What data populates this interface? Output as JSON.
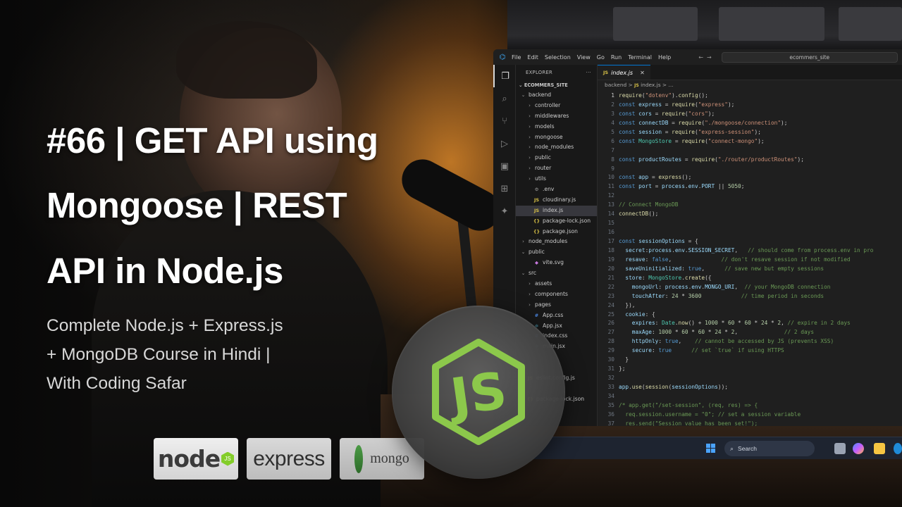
{
  "title_lines": [
    "#66 | GET API using",
    "Mongoose | REST",
    "API in Node.js"
  ],
  "subtitle_lines": [
    "Complete Node.js + Express.js",
    "+ MongoDB Course in Hindi |",
    "With Coding Safar"
  ],
  "badges": {
    "node": "node",
    "node_js": "JS",
    "express": "express",
    "mongo": "mongo"
  },
  "circle_logo": "JS",
  "vscode": {
    "menu": [
      "File",
      "Edit",
      "Selection",
      "View",
      "Go",
      "Run",
      "Terminal",
      "Help"
    ],
    "search": "ecommers_site",
    "explorer_title": "EXPLORER",
    "explorer_more": "···",
    "root_folder": "ECOMMERS_SITE",
    "tab": {
      "icon": "JS",
      "label": "index.js"
    },
    "breadcrumb": {
      "folder": "backend",
      "sep": ">",
      "icon": "JS",
      "file": "index.js",
      "tail": "> ..."
    },
    "tree": [
      {
        "label": "backend",
        "depth": 0,
        "chev": "⌄",
        "icon": ""
      },
      {
        "label": "controller",
        "depth": 1,
        "chev": "›",
        "icon": ""
      },
      {
        "label": "middlewares",
        "depth": 1,
        "chev": "›",
        "icon": ""
      },
      {
        "label": "models",
        "depth": 1,
        "chev": "›",
        "icon": ""
      },
      {
        "label": "mongoose",
        "depth": 1,
        "chev": "›",
        "icon": ""
      },
      {
        "label": "node_modules",
        "depth": 1,
        "chev": "›",
        "icon": ""
      },
      {
        "label": "public",
        "depth": 1,
        "chev": "›",
        "icon": ""
      },
      {
        "label": "router",
        "depth": 1,
        "chev": "›",
        "icon": ""
      },
      {
        "label": "utils",
        "depth": 1,
        "chev": "›",
        "icon": ""
      },
      {
        "label": ".env",
        "depth": 1,
        "chev": "",
        "icon": "⚙"
      },
      {
        "label": "cloudinary.js",
        "depth": 1,
        "chev": "",
        "icon": "JS"
      },
      {
        "label": "index.js",
        "depth": 1,
        "chev": "",
        "icon": "JS",
        "selected": true
      },
      {
        "label": "package-lock.json",
        "depth": 1,
        "chev": "",
        "icon": "{}"
      },
      {
        "label": "package.json",
        "depth": 1,
        "chev": "",
        "icon": "{}"
      },
      {
        "label": "node_modules",
        "depth": 0,
        "chev": "›",
        "icon": ""
      },
      {
        "label": "public",
        "depth": 0,
        "chev": "⌄",
        "icon": ""
      },
      {
        "label": "vite.svg",
        "depth": 1,
        "chev": "",
        "icon": "◆"
      },
      {
        "label": "src",
        "depth": 0,
        "chev": "⌄",
        "icon": ""
      },
      {
        "label": "assets",
        "depth": 1,
        "chev": "›",
        "icon": ""
      },
      {
        "label": "components",
        "depth": 1,
        "chev": "›",
        "icon": ""
      },
      {
        "label": "pages",
        "depth": 1,
        "chev": "›",
        "icon": ""
      },
      {
        "label": "App.css",
        "depth": 1,
        "chev": "",
        "icon": "#"
      },
      {
        "label": "App.jsx",
        "depth": 1,
        "chev": "",
        "icon": "⚛"
      },
      {
        "label": "index.css",
        "depth": 1,
        "chev": "",
        "icon": "#"
      },
      {
        "label": "main.jsx",
        "depth": 1,
        "chev": "",
        "icon": "⚛"
      },
      {
        "label": "",
        "depth": 0,
        "chev": "",
        "icon": ""
      },
      {
        "label": "",
        "depth": 0,
        "chev": "",
        "icon": ""
      },
      {
        "label": "eslint.config.js",
        "depth": 0,
        "chev": "",
        "icon": "JS"
      },
      {
        "label": "",
        "depth": 0,
        "chev": "",
        "icon": ""
      },
      {
        "label": "package-lock.json",
        "depth": 0,
        "chev": "",
        "icon": "{}"
      }
    ],
    "code": [
      [
        [
          "fn",
          "require"
        ],
        [
          "p",
          "("
        ],
        [
          "str",
          "\"dotenv\""
        ],
        [
          "p",
          ")."
        ],
        [
          "fn",
          "config"
        ],
        [
          "p",
          "();"
        ]
      ],
      [
        [
          "kw",
          "const "
        ],
        [
          "var",
          "express"
        ],
        [
          "p",
          " = "
        ],
        [
          "fn",
          "require"
        ],
        [
          "p",
          "("
        ],
        [
          "str",
          "\"express\""
        ],
        [
          "p",
          ");"
        ]
      ],
      [
        [
          "kw",
          "const "
        ],
        [
          "var",
          "cors"
        ],
        [
          "p",
          " = "
        ],
        [
          "fn",
          "require"
        ],
        [
          "p",
          "("
        ],
        [
          "str",
          "\"cors\""
        ],
        [
          "p",
          ");"
        ]
      ],
      [
        [
          "kw",
          "const "
        ],
        [
          "var",
          "connectDB"
        ],
        [
          "p",
          " = "
        ],
        [
          "fn",
          "require"
        ],
        [
          "p",
          "("
        ],
        [
          "str",
          "\"./mongoose/connection\""
        ],
        [
          "p",
          ");"
        ]
      ],
      [
        [
          "kw",
          "const "
        ],
        [
          "var",
          "session"
        ],
        [
          "p",
          " = "
        ],
        [
          "fn",
          "require"
        ],
        [
          "p",
          "("
        ],
        [
          "str",
          "\"express-session\""
        ],
        [
          "p",
          ");"
        ]
      ],
      [
        [
          "kw",
          "const "
        ],
        [
          "cls",
          "MongoStore"
        ],
        [
          "p",
          " = "
        ],
        [
          "fn",
          "require"
        ],
        [
          "p",
          "("
        ],
        [
          "str",
          "\"connect-mongo\""
        ],
        [
          "p",
          ");"
        ]
      ],
      [],
      [
        [
          "kw",
          "const "
        ],
        [
          "var",
          "productRoutes"
        ],
        [
          "p",
          " = "
        ],
        [
          "fn",
          "require"
        ],
        [
          "p",
          "("
        ],
        [
          "str",
          "\"./router/productRoutes\""
        ],
        [
          "p",
          ");"
        ]
      ],
      [],
      [
        [
          "kw",
          "const "
        ],
        [
          "var",
          "app"
        ],
        [
          "p",
          " = "
        ],
        [
          "fn",
          "express"
        ],
        [
          "p",
          "();"
        ]
      ],
      [
        [
          "kw",
          "const "
        ],
        [
          "var",
          "port"
        ],
        [
          "p",
          " = "
        ],
        [
          "var",
          "process"
        ],
        [
          "p",
          "."
        ],
        [
          "var",
          "env"
        ],
        [
          "p",
          "."
        ],
        [
          "var",
          "PORT"
        ],
        [
          "p",
          " || "
        ],
        [
          "num",
          "5050"
        ],
        [
          "p",
          ";"
        ]
      ],
      [],
      [
        [
          "com",
          "// Connect MongoDB"
        ]
      ],
      [
        [
          "fn",
          "connectDB"
        ],
        [
          "p",
          "();"
        ]
      ],
      [],
      [],
      [
        [
          "kw",
          "const "
        ],
        [
          "var",
          "sessionOptions"
        ],
        [
          "p",
          " = {"
        ]
      ],
      [
        [
          "p",
          "  "
        ],
        [
          "var",
          "secret"
        ],
        [
          "p",
          ":"
        ],
        [
          "var",
          "process"
        ],
        [
          "p",
          "."
        ],
        [
          "var",
          "env"
        ],
        [
          "p",
          "."
        ],
        [
          "var",
          "SESSION_SECRET"
        ],
        [
          "p",
          ",   "
        ],
        [
          "com",
          "// should come from process.env in pro"
        ]
      ],
      [
        [
          "p",
          "  "
        ],
        [
          "var",
          "resave"
        ],
        [
          "p",
          ": "
        ],
        [
          "kw",
          "false"
        ],
        [
          "p",
          ",               "
        ],
        [
          "com",
          "// don't resave session if not modified"
        ]
      ],
      [
        [
          "p",
          "  "
        ],
        [
          "var",
          "saveUninitialized"
        ],
        [
          "p",
          ": "
        ],
        [
          "kw",
          "true"
        ],
        [
          "p",
          ",      "
        ],
        [
          "com",
          "// save new but empty sessions"
        ]
      ],
      [
        [
          "p",
          "  "
        ],
        [
          "var",
          "store"
        ],
        [
          "p",
          ": "
        ],
        [
          "cls",
          "MongoStore"
        ],
        [
          "p",
          "."
        ],
        [
          "fn",
          "create"
        ],
        [
          "p",
          "({"
        ]
      ],
      [
        [
          "p",
          "    "
        ],
        [
          "var",
          "mongoUrl"
        ],
        [
          "p",
          ": "
        ],
        [
          "var",
          "process"
        ],
        [
          "p",
          "."
        ],
        [
          "var",
          "env"
        ],
        [
          "p",
          "."
        ],
        [
          "var",
          "MONGO_URI"
        ],
        [
          "p",
          ",  "
        ],
        [
          "com",
          "// your MongoDB connection"
        ]
      ],
      [
        [
          "p",
          "    "
        ],
        [
          "var",
          "touchAfter"
        ],
        [
          "p",
          ": "
        ],
        [
          "num",
          "24"
        ],
        [
          "p",
          " * "
        ],
        [
          "num",
          "3600"
        ],
        [
          "p",
          "            "
        ],
        [
          "com",
          "// time period in seconds"
        ]
      ],
      [
        [
          "p",
          "  }),"
        ]
      ],
      [
        [
          "p",
          "  "
        ],
        [
          "var",
          "cookie"
        ],
        [
          "p",
          ": {"
        ]
      ],
      [
        [
          "p",
          "    "
        ],
        [
          "var",
          "expires"
        ],
        [
          "p",
          ": "
        ],
        [
          "cls",
          "Date"
        ],
        [
          "p",
          "."
        ],
        [
          "fn",
          "now"
        ],
        [
          "p",
          "() + "
        ],
        [
          "num",
          "1000"
        ],
        [
          "p",
          " * "
        ],
        [
          "num",
          "60"
        ],
        [
          "p",
          " * "
        ],
        [
          "num",
          "60"
        ],
        [
          "p",
          " * "
        ],
        [
          "num",
          "24"
        ],
        [
          "p",
          " * "
        ],
        [
          "num",
          "2"
        ],
        [
          "p",
          ", "
        ],
        [
          "com",
          "// expire in 2 days"
        ]
      ],
      [
        [
          "p",
          "    "
        ],
        [
          "var",
          "maxAge"
        ],
        [
          "p",
          ": "
        ],
        [
          "num",
          "1000"
        ],
        [
          "p",
          " * "
        ],
        [
          "num",
          "60"
        ],
        [
          "p",
          " * "
        ],
        [
          "num",
          "60"
        ],
        [
          "p",
          " * "
        ],
        [
          "num",
          "24"
        ],
        [
          "p",
          " * "
        ],
        [
          "num",
          "2"
        ],
        [
          "p",
          ",              "
        ],
        [
          "com",
          "// 2 days"
        ]
      ],
      [
        [
          "p",
          "    "
        ],
        [
          "var",
          "httpOnly"
        ],
        [
          "p",
          ": "
        ],
        [
          "kw",
          "true"
        ],
        [
          "p",
          ",    "
        ],
        [
          "com",
          "// cannot be accessed by JS (prevents XSS)"
        ]
      ],
      [
        [
          "p",
          "    "
        ],
        [
          "var",
          "secure"
        ],
        [
          "p",
          ": "
        ],
        [
          "kw",
          "true"
        ],
        [
          "p",
          "      "
        ],
        [
          "com",
          "// set `true` if using HTTPS"
        ]
      ],
      [
        [
          "p",
          "  }"
        ]
      ],
      [
        [
          "p",
          "};"
        ]
      ],
      [],
      [
        [
          "var",
          "app"
        ],
        [
          "p",
          "."
        ],
        [
          "fn",
          "use"
        ],
        [
          "p",
          "("
        ],
        [
          "fn",
          "session"
        ],
        [
          "p",
          "("
        ],
        [
          "var",
          "sessionOptions"
        ],
        [
          "p",
          "));"
        ]
      ],
      [],
      [
        [
          "com",
          "/* app.get(\"/set-session\", (req, res) => {"
        ]
      ],
      [
        [
          "com",
          "  req.session.username = \"0\"; // set a session variable"
        ]
      ],
      [
        [
          "com",
          "  res.send(\"Session value has been set!\");"
        ]
      ]
    ],
    "taskbar_search": "Search"
  }
}
